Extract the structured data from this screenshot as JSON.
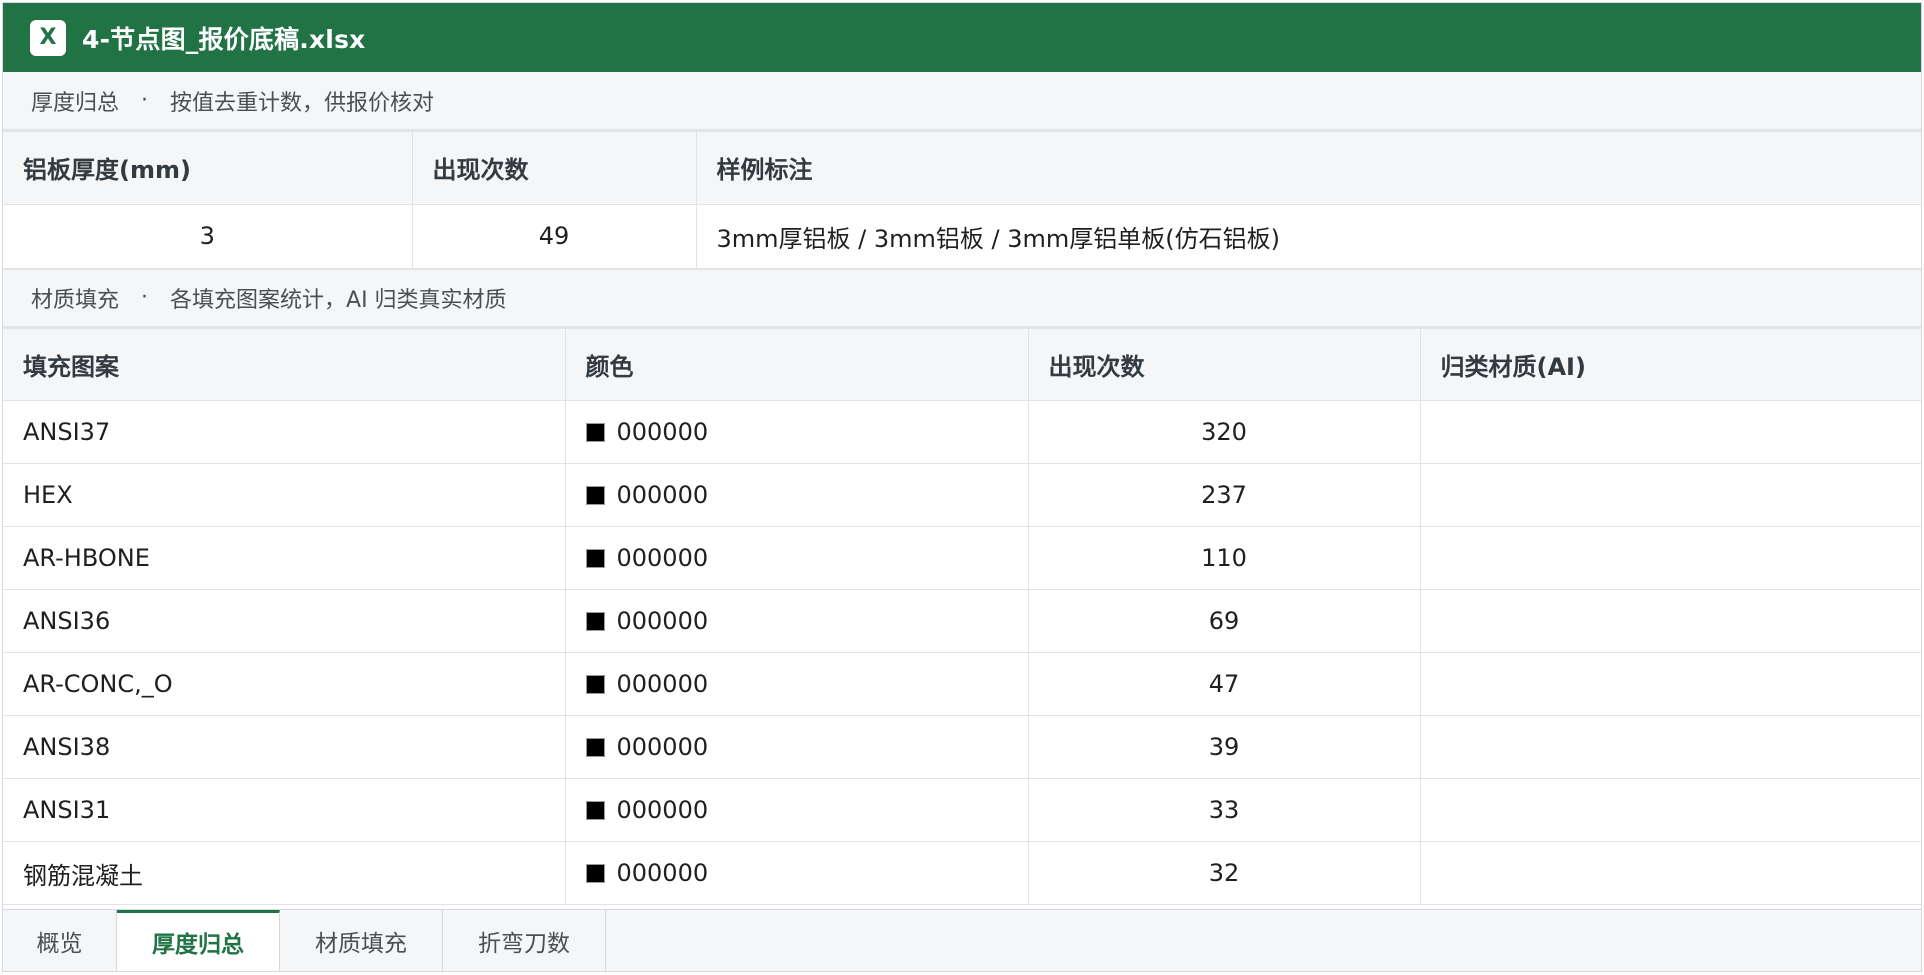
{
  "app": {
    "icon": "excel-icon",
    "icon_glyph": "X",
    "file_name": "4-节点图_报价底稿.xlsx",
    "accent_color": "#217346"
  },
  "thickness_section": {
    "title": "厚度归总",
    "separator": "·",
    "description": "按值去重计数，供报价核对",
    "headers": [
      "铝板厚度(mm)",
      "出现次数",
      "样例标注"
    ],
    "rows": [
      [
        "3",
        "49",
        "3mm厚铝板 / 3mm铝板 / 3mm厚铝单板(仿石铝板)"
      ]
    ]
  },
  "material_section": {
    "title": "材质填充",
    "separator": "·",
    "description": "各填充图案统计，AI 归类真实材质",
    "headers": [
      "填充图案",
      "颜色",
      "出现次数",
      "归类材质(AI)"
    ],
    "rows": [
      [
        "ANSI37",
        "000000",
        "320",
        ""
      ],
      [
        "HEX",
        "000000",
        "237",
        ""
      ],
      [
        "AR-HBONE",
        "000000",
        "110",
        ""
      ],
      [
        "ANSI36",
        "000000",
        "69",
        ""
      ],
      [
        "AR-CONC,_O",
        "000000",
        "47",
        ""
      ],
      [
        "ANSI38",
        "000000",
        "39",
        ""
      ],
      [
        "ANSI31",
        "000000",
        "33",
        ""
      ],
      [
        "钢筋混凝土",
        "000000",
        "32",
        ""
      ]
    ]
  },
  "tabs": [
    {
      "label": "概览",
      "active": false
    },
    {
      "label": "厚度归总",
      "active": true
    },
    {
      "label": "材质填充",
      "active": false
    },
    {
      "label": "折弯刀数",
      "active": false
    }
  ]
}
